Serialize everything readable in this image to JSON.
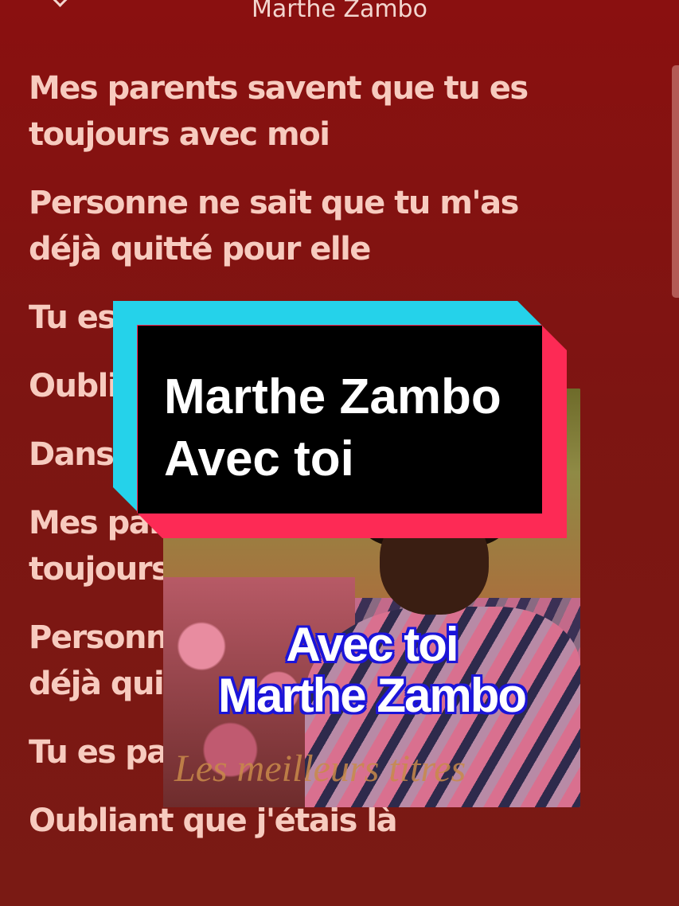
{
  "header": {
    "title": "Marthe Zambo"
  },
  "lyrics": [
    "Mes parents savent que tu es\ntoujours avec moi",
    "Personne ne sait que tu m'as\ndéjà quitté pour elle",
    "Tu es",
    "Oubli",
    "Dans",
    "Mes pare\ntoujours",
    "Personne\ndéjà quit",
    "Tu es par",
    "Oubliant que j'étais là"
  ],
  "overlay": {
    "line1": "Marthe Zambo",
    "line2": "Avec toi"
  },
  "album_art": {
    "line1": "Avec toi",
    "line2": "Marthe Zambo",
    "subtitle": "Les meilleurs titres"
  },
  "colors": {
    "background": "#7d1512",
    "lyric_text": "#f7cbbf",
    "overlay_cyan": "#25d2ea",
    "overlay_pink": "#fd2a55",
    "art_text_outline": "#1b14d9"
  }
}
